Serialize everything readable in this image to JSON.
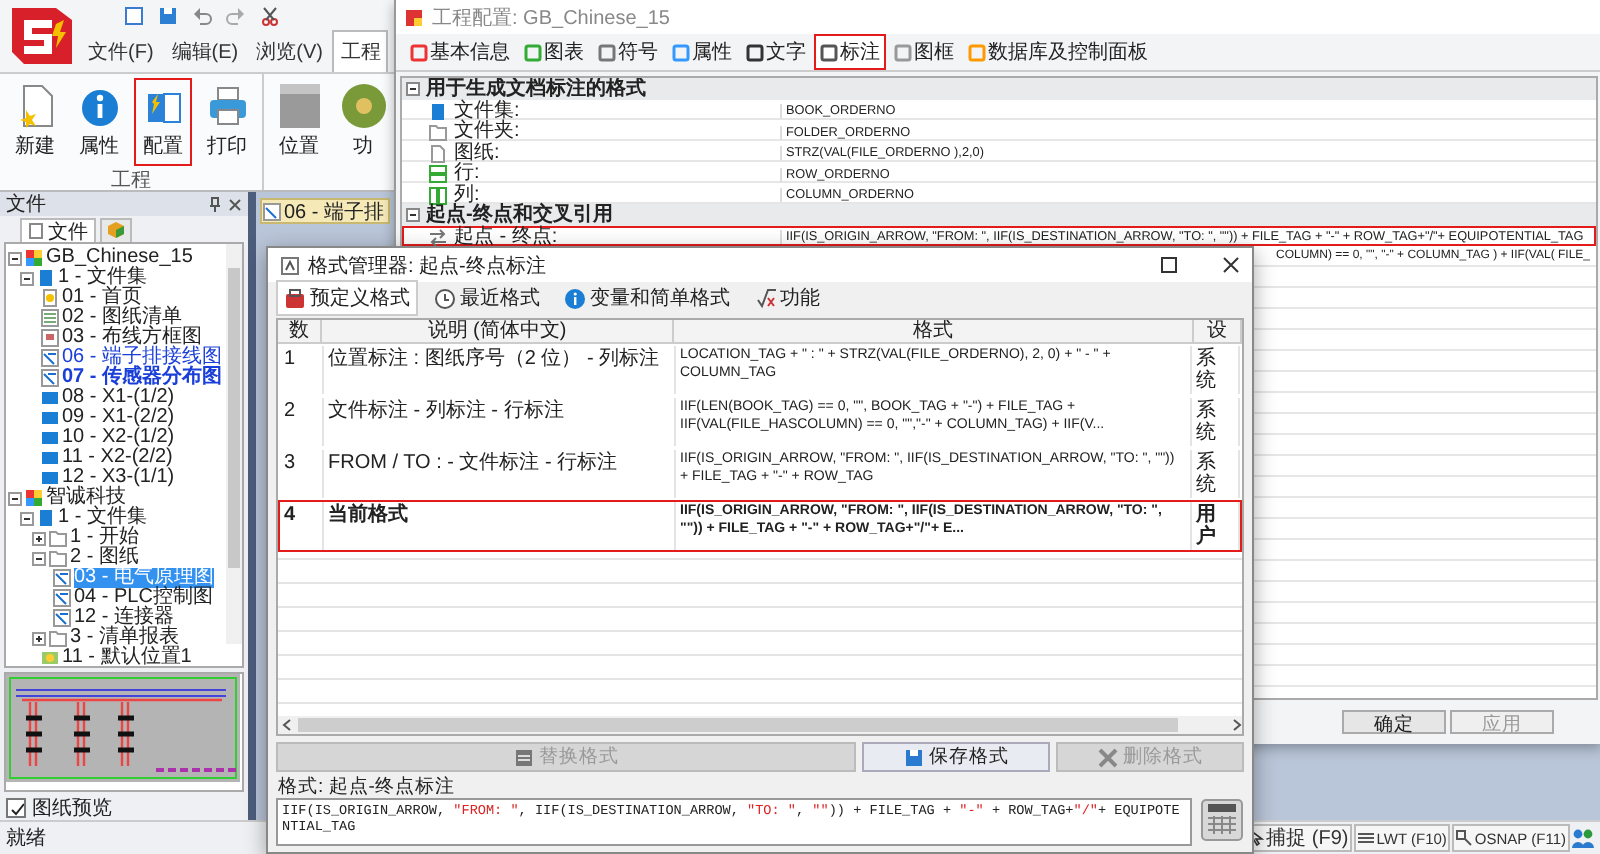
{
  "app": {
    "menu_tabs": [
      {
        "label": "文件(F)",
        "selected": false
      },
      {
        "label": "编辑(E)",
        "selected": false
      },
      {
        "label": "浏览(V)",
        "selected": false
      },
      {
        "label": "工程",
        "selected": true
      }
    ],
    "ribbon": {
      "groups": [
        {
          "label": "工程",
          "buttons": [
            {
              "label": "新建",
              "kind": "new",
              "highlighted": false
            },
            {
              "label": "属性",
              "kind": "info",
              "highlighted": false
            },
            {
              "label": "配置",
              "kind": "config",
              "highlighted": true
            },
            {
              "label": "打印",
              "kind": "print",
              "highlighted": false
            }
          ]
        },
        {
          "buttons": [
            {
              "label": "位置",
              "kind": "box",
              "highlighted": false
            },
            {
              "label": "功",
              "kind": "gear",
              "highlighted": false
            }
          ]
        }
      ]
    },
    "file_panel": {
      "title": "文件",
      "tab": "文件",
      "tree": [
        {
          "label": "GB_Chinese_15",
          "kind": "project",
          "expanded": true,
          "selected": false,
          "children": [
            {
              "label": "1 - 文件集",
              "kind": "book",
              "expanded": true,
              "selected": false,
              "children": [
                {
                  "label": "01 - 首页",
                  "kind": "cover",
                  "open": false,
                  "current": false,
                  "selected": false
                },
                {
                  "label": "02 - 图纸清单",
                  "kind": "list",
                  "open": false,
                  "current": false,
                  "selected": false
                },
                {
                  "label": "03 - 布线方框图",
                  "kind": "block",
                  "open": false,
                  "current": false,
                  "selected": false
                },
                {
                  "label": "06 - 端子排接线图",
                  "kind": "schematic",
                  "open": true,
                  "current": false,
                  "selected": false
                },
                {
                  "label": "07 - 传感器分布图",
                  "kind": "schematic",
                  "open": true,
                  "current": true,
                  "selected": false
                },
                {
                  "label": "08 - X1-(1/2)",
                  "kind": "terminal",
                  "open": false,
                  "current": false,
                  "selected": false
                },
                {
                  "label": "09 - X1-(2/2)",
                  "kind": "terminal",
                  "open": false,
                  "current": false,
                  "selected": false
                },
                {
                  "label": "10 - X2-(1/2)",
                  "kind": "terminal",
                  "open": false,
                  "current": false,
                  "selected": false
                },
                {
                  "label": "11 - X2-(2/2)",
                  "kind": "terminal",
                  "open": false,
                  "current": false,
                  "selected": false
                },
                {
                  "label": "12 - X3-(1/1)",
                  "kind": "terminal",
                  "open": false,
                  "current": false,
                  "selected": false
                }
              ]
            }
          ]
        },
        {
          "label": "智诚科技",
          "kind": "project",
          "expanded": true,
          "selected": false,
          "children": [
            {
              "label": "1 - 文件集",
              "kind": "book",
              "expanded": true,
              "selected": false,
              "children": [
                {
                  "label": "1 - 开始",
                  "kind": "folder",
                  "expanded": false,
                  "selected": false
                },
                {
                  "label": "2 - 图纸",
                  "kind": "folder",
                  "expanded": true,
                  "selected": false,
                  "children": [
                    {
                      "label": "03 - 电气原理图",
                      "kind": "schematic",
                      "open": false,
                      "current": false,
                      "selected": true
                    },
                    {
                      "label": "04 - PLC控制图",
                      "kind": "schematic",
                      "open": false,
                      "current": false,
                      "selected": false
                    },
                    {
                      "label": "12 - 连接器",
                      "kind": "schematic",
                      "open": false,
                      "current": false,
                      "selected": false
                    }
                  ]
                },
                {
                  "label": "3 - 清单报表",
                  "kind": "folder",
                  "expanded": false,
                  "selected": false
                },
                {
                  "label": "11 - 默认位置1",
                  "kind": "location",
                  "selected": false
                }
              ]
            }
          ]
        }
      ],
      "preview_checkbox": {
        "label": "图纸预览",
        "checked": true
      }
    },
    "doc_tab": "06 - 端子排",
    "status": "就绪",
    "status_bar": [
      {
        "label": "捕捉 (F9)",
        "kind": "cursor"
      },
      {
        "label": "LWT (F10)",
        "kind": "lines"
      },
      {
        "label": "OSNAP (F11)",
        "kind": "snap"
      }
    ]
  },
  "config": {
    "title": "工程配置: GB_Chinese_15",
    "tabs": [
      {
        "label": "基本信息",
        "selected": false,
        "highlighted": false
      },
      {
        "label": "图表",
        "selected": false,
        "highlighted": false
      },
      {
        "label": "符号",
        "selected": false,
        "highlighted": false
      },
      {
        "label": "属性",
        "selected": false,
        "highlighted": false
      },
      {
        "label": "文字",
        "selected": false,
        "highlighted": false
      },
      {
        "label": "标注",
        "selected": true,
        "highlighted": true
      },
      {
        "label": "图框",
        "selected": false,
        "highlighted": false
      },
      {
        "label": "数据库及控制面板",
        "selected": false,
        "highlighted": false
      }
    ],
    "sections": [
      {
        "title": "用于生成文档标注的格式",
        "expanded": true,
        "rows": [
          {
            "name": "文件集:",
            "kind": "book",
            "value": "BOOK_ORDERNO",
            "highlighted": false
          },
          {
            "name": "文件夹:",
            "kind": "folder",
            "value": "FOLDER_ORDERNO",
            "highlighted": false
          },
          {
            "name": "图纸:",
            "kind": "page",
            "value": "STRZ(VAL(FILE_ORDERNO ),2,0)",
            "highlighted": false
          },
          {
            "name": "行:",
            "kind": "row",
            "value": "ROW_ORDERNO",
            "highlighted": false
          },
          {
            "name": "列:",
            "kind": "column",
            "value": "COLUMN_ORDERNO",
            "highlighted": false
          }
        ]
      },
      {
        "title": "起点-终点和交叉引用",
        "expanded": true,
        "rows": [
          {
            "name": "起点 - 终点:",
            "kind": "link",
            "value": "IIF(IS_ORIGIN_ARROW, \"FROM: \", IIF(IS_DESTINATION_ARROW, \"TO:  \", \"\")) + FILE_TAG + \"-\" + ROW_TAG+\"/\"+ EQUIPOTENTIAL_TAG",
            "highlighted": true
          },
          {
            "value": "COLUMN) == 0, \"\", \"-\" + COLUMN_TAG ) + IIF(VAL( FILE_",
            "highlighted": false
          }
        ]
      }
    ],
    "buttons": [
      {
        "label": "确定",
        "disabled": false
      },
      {
        "label": "应用",
        "disabled": true
      }
    ]
  },
  "format_manager": {
    "title": "格式管理器: 起点-终点标注",
    "toolbar": [
      {
        "label": "预定义格式",
        "kind": "predefined"
      },
      {
        "label": "最近格式",
        "kind": "recent"
      },
      {
        "label": "变量和简单格式",
        "kind": "variables"
      },
      {
        "label": "功能",
        "kind": "function"
      }
    ],
    "table": {
      "columns": [
        "数",
        "说明 (简体中文)",
        "格式",
        "设"
      ],
      "rows": [
        {
          "cells": [
            "1",
            "位置标注 : 图纸序号（2 位） - 列标注",
            "LOCATION_TAG + \" : \" + STRZ(VAL(FILE_ORDERNO), 2, 0) + \" - \" + COLUMN_TAG",
            "系统"
          ],
          "selected": false,
          "highlighted": false
        },
        {
          "cells": [
            "2",
            "文件标注 - 列标注 - 行标注",
            "IIF(LEN(BOOK_TAG) == 0, \"\", BOOK_TAG + \"-\") + FILE_TAG + IIF(VAL(FILE_HASCOLUMN) == 0, \"\",\"-\" + COLUMN_TAG) + IIF(V...",
            "系统"
          ],
          "selected": false,
          "highlighted": false
        },
        {
          "cells": [
            "3",
            "FROM / TO : - 文件标注 - 行标注",
            "IIF(IS_ORIGIN_ARROW, \"FROM: \", IIF(IS_DESTINATION_ARROW, \"TO:  \", \"\")) + FILE_TAG + \"-\" + ROW_TAG",
            "系统"
          ],
          "selected": false,
          "highlighted": false
        },
        {
          "cells": [
            "4",
            "当前格式",
            "IIF(IS_ORIGIN_ARROW, \"FROM: \", IIF(IS_DESTINATION_ARROW, \"TO:  \", \"\")) + FILE_TAG + \"-\" + ROW_TAG+\"/\"+ E...",
            "用户"
          ],
          "selected": true,
          "highlighted": true
        }
      ]
    },
    "buttons": [
      {
        "label": "替换格式",
        "disabled": true
      },
      {
        "label": "保存格式",
        "disabled": false
      },
      {
        "label": "删除格式",
        "disabled": true
      }
    ],
    "format_label": "格式: 起点-终点标注",
    "format_value": "IIF(IS_ORIGIN_ARROW, \"FROM: \", IIF(IS_DESTINATION_ARROW, \"TO:  \", \"\")) + FILE_TAG + \"-\" + ROW_TAG+\"/\"+ EQUIPOTENTIAL_TAG"
  }
}
